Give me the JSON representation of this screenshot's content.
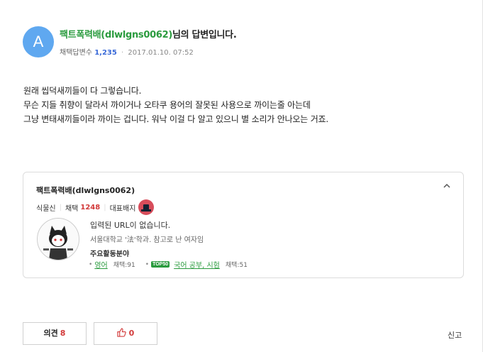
{
  "answer": {
    "avatar_letter": "A",
    "nickname": "팩트폭력배(dlwlgns0062)",
    "title_suffix": "님의 답변입니다.",
    "meta_label": "채택답변수",
    "answer_count": "1,235",
    "date": "2017.01.10. 07:52",
    "body_lines": [
      "원래 씹덕새끼들이 다 그렇습니다.",
      "무슨 지들 취향이 달라서 까이거나 오타쿠 용어의 잘못된 사용으로 까이는줄 아는데",
      "그냥 변태새끼들이라 까이는 겁니다. 워낙 이걸 다 알고 있으니 별 소리가 안나오는 거죠."
    ]
  },
  "profile": {
    "name": "팩트폭력배(dlwlgns0062)",
    "collapse_icon": "chevron-up-icon",
    "rank": "식물신",
    "adopt_label": "채택",
    "adopt_count": "1248",
    "badge_label": "대표배지",
    "url_text": "입력된 URL이 없습니다.",
    "intro": "서울대학교 '法'학과. 참고로 난 여자임",
    "fields_heading": "주요활동분야",
    "fields": [
      {
        "name": "영어",
        "count_text": "채택:91",
        "top_badge": ""
      },
      {
        "name": "국어 공부, 시험",
        "count_text": "채택:51",
        "top_badge": "TOP50"
      }
    ]
  },
  "actions": {
    "opinion_label": "의견",
    "opinion_count": "8",
    "like_count": "0",
    "report_label": "신고"
  },
  "colors": {
    "nickname": "#2a9b3e",
    "count_blue": "#3a6ad8",
    "count_red": "#d23a3a",
    "avatar_bg": "#5fa8f0"
  }
}
